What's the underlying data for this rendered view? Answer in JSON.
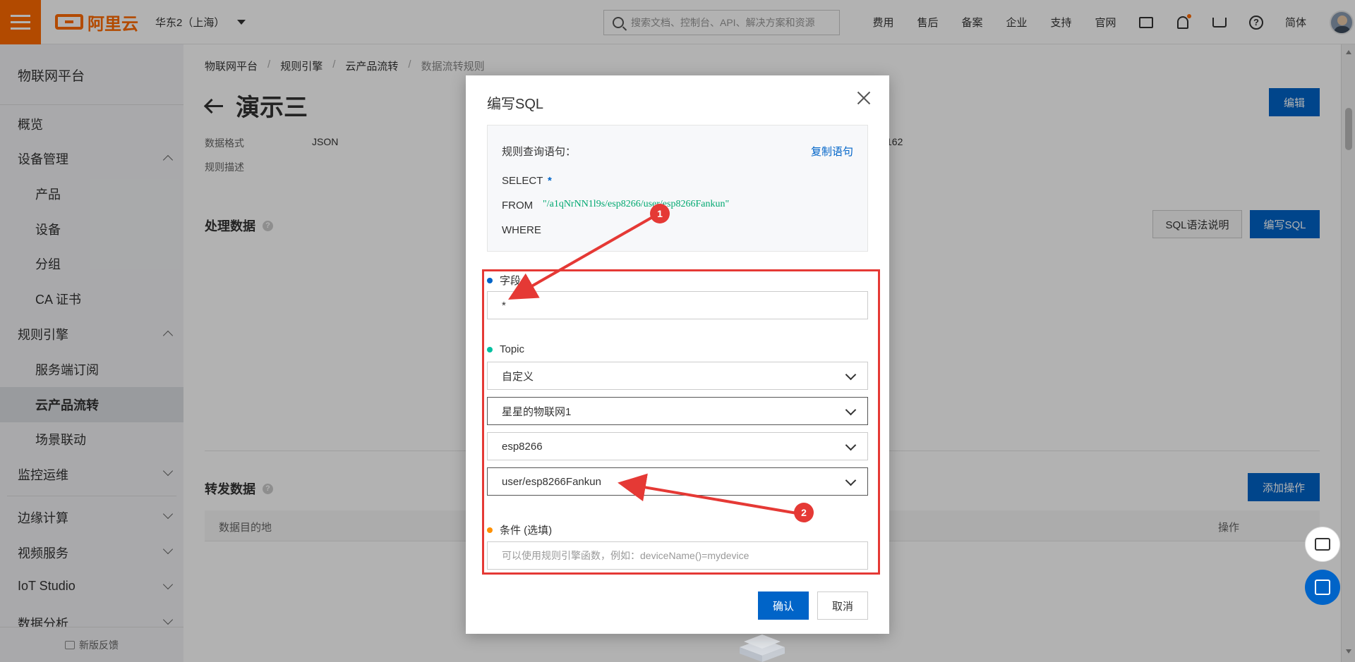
{
  "topbar": {
    "logo_text": "阿里云",
    "region": "华东2（上海）",
    "search_placeholder": "搜索文档、控制台、API、解决方案和资源",
    "nav": [
      "费用",
      "售后",
      "备案",
      "企业",
      "支持",
      "官网"
    ],
    "lang": "简体",
    "icons": [
      "terminal-icon",
      "bell-icon",
      "cart-icon",
      "help-icon"
    ]
  },
  "sidebar": {
    "title": "物联网平台",
    "items": [
      {
        "label": "概览"
      },
      {
        "label": "设备管理",
        "expanded": true
      },
      {
        "label": "产品"
      },
      {
        "label": "设备"
      },
      {
        "label": "分组"
      },
      {
        "label": "CA 证书"
      },
      {
        "label": "规则引擎",
        "expanded": true
      },
      {
        "label": "服务端订阅"
      },
      {
        "label": "云产品流转",
        "active": true
      },
      {
        "label": "场景联动"
      },
      {
        "label": "监控运维",
        "expanded": false
      },
      {
        "label": "边缘计算",
        "expanded": false
      },
      {
        "label": "视频服务",
        "expanded": false
      },
      {
        "label": "IoT Studio",
        "expanded": false
      },
      {
        "label": "数据分析",
        "expanded": false
      }
    ],
    "feedback": "新版反馈"
  },
  "main": {
    "breadcrumb": [
      "物联网平台",
      "规则引擎",
      "云产品流转",
      "数据流转规则"
    ],
    "title": "演示三",
    "edit_button": "编辑",
    "meta": {
      "format_label": "数据格式",
      "format_value": "JSON",
      "desc_label": "规则描述",
      "clipped_value": "162"
    },
    "process_section": {
      "title": "处理数据",
      "sql_help_button": "SQL语法说明",
      "write_sql_button": "编写SQL"
    },
    "forward_section": {
      "title": "转发数据",
      "add_button": "添加操作",
      "columns": [
        "数据目的地",
        "操作"
      ]
    }
  },
  "modal": {
    "title": "编写SQL",
    "query_label": "规则查询语句：",
    "copy_label": "复制语句",
    "sql": {
      "select_kw": "SELECT",
      "select_val": "*",
      "from_kw": "FROM",
      "from_val": "\"/a1qNrNN1l9s/esp8266/user/esp8266Fankun\"",
      "where_kw": "WHERE"
    },
    "field_label": "字段",
    "field_value": "*",
    "topic_label": "Topic",
    "topic_selects": [
      "自定义",
      "星星的物联网1",
      "esp8266",
      "user/esp8266Fankun"
    ],
    "condition_label": "条件 (选填)",
    "condition_placeholder": "可以使用规则引擎函数，例如：deviceName()=mydevice",
    "ok_button": "确认",
    "cancel_button": "取消"
  },
  "annotations": {
    "badge1": "1",
    "badge2": "2",
    "color": "#e53935"
  },
  "colors": {
    "brand": "#ff6a00",
    "primary": "#0064c8",
    "sql_path": "#00a870"
  }
}
